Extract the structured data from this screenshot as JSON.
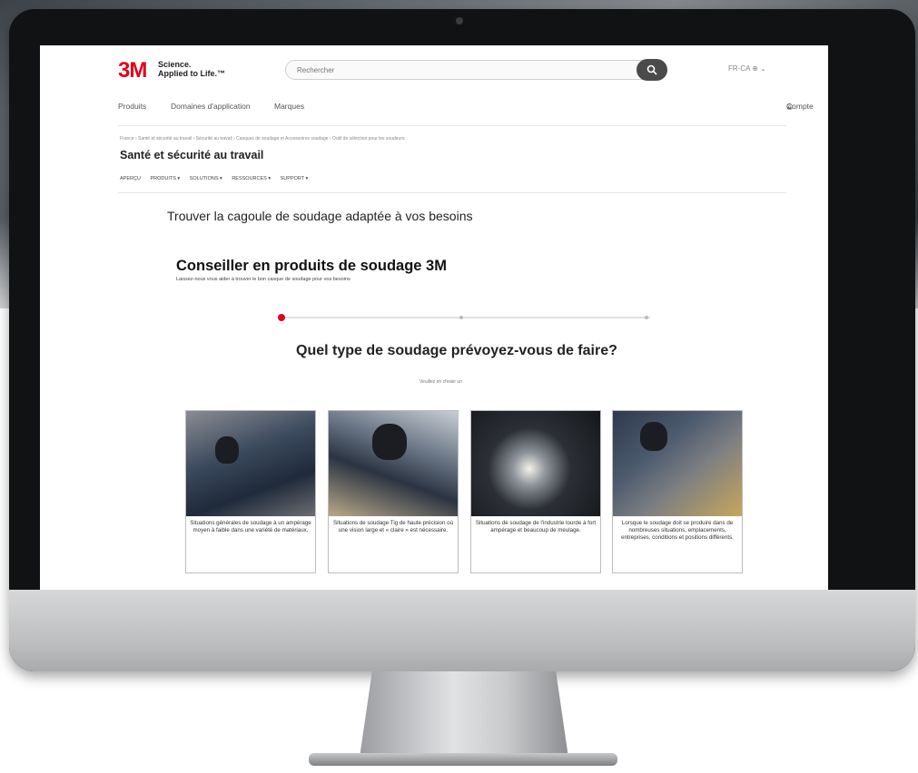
{
  "header": {
    "logo": "3M",
    "tagline_line1": "Science.",
    "tagline_line2": "Applied to Life.™",
    "search_placeholder": "Rechercher",
    "lang": "FR-CA"
  },
  "nav": {
    "items": [
      "Produits",
      "Domaines d'application",
      "Marques"
    ],
    "account": "Compte"
  },
  "breadcrumb": "France › Santé et sécurité au travail › Sécurité au travail › Casques de soudage et Accessoires soudage › Outil de sélection pour les soudeurs",
  "section_title": "Santé et sécurité au travail",
  "subnav": [
    "APERÇU",
    "PRODUITS ▾",
    "SOLUTIONS ▾",
    "RESSOURCES ▾",
    "SUPPORT ▾"
  ],
  "main": {
    "heading": "Trouver la cagoule de soudage adaptée à vos besoins",
    "advisor_title": "Conseiller en produits de soudage 3M",
    "advisor_subtitle": "Laissez-nous vous aider à trouver le bon casque de soudage pour vos besoins",
    "progress_step": "1",
    "question": "Quel type de soudage prévoyez-vous de faire?",
    "choose_hint": "Veuillez en choisir un"
  },
  "cards": [
    {
      "text": "Situations générales de soudage à un ampérage moyen à faible dans une variété de matériaux."
    },
    {
      "text": "Situations de soudage Tig de haute précision où une vision large et « claire » est nécessaire."
    },
    {
      "text": "Situations de soudage de l'industrie lourde à fort ampérage et beaucoup de meulage."
    },
    {
      "text": "Lorsque le soudage doit se produire dans de nombreuses situations, emplacements, entreprises, conditions et positions différents."
    }
  ],
  "colors": {
    "brand": "#e3001b",
    "text": "#222222"
  }
}
